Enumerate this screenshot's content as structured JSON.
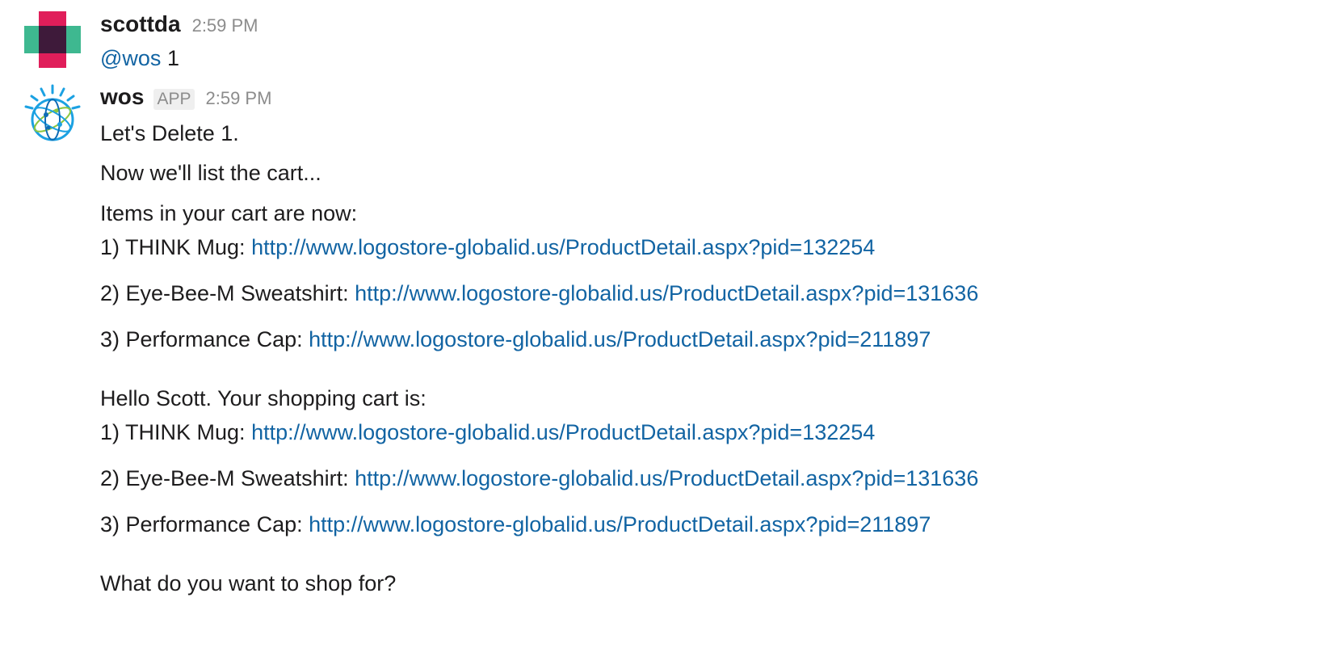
{
  "messages": [
    {
      "author": "scottda",
      "time": "2:59 PM",
      "mention": "@wos",
      "text": " 1"
    },
    {
      "author": "wos",
      "badge": "APP",
      "time": "2:59 PM",
      "lines": {
        "l1": "Let's Delete 1.",
        "l2": "Now we'll list the cart...",
        "l3": "Items in your cart are now:",
        "cart1": [
          {
            "label": "1) THINK Mug: ",
            "url": "http://www.logostore-globalid.us/ProductDetail.aspx?pid=132254"
          },
          {
            "label": "2) Eye-Bee-M Sweatshirt: ",
            "url": "http://www.logostore-globalid.us/ProductDetail.aspx?pid=131636"
          },
          {
            "label": "3) Performance Cap: ",
            "url": "http://www.logostore-globalid.us/ProductDetail.aspx?pid=211897"
          }
        ],
        "l4": "Hello Scott. Your shopping cart is:",
        "cart2": [
          {
            "label": "1) THINK Mug: ",
            "url": "http://www.logostore-globalid.us/ProductDetail.aspx?pid=132254"
          },
          {
            "label": "2) Eye-Bee-M Sweatshirt: ",
            "url": "http://www.logostore-globalid.us/ProductDetail.aspx?pid=131636"
          },
          {
            "label": "3) Performance Cap: ",
            "url": "http://www.logostore-globalid.us/ProductDetail.aspx?pid=211897"
          }
        ],
        "l5": "What do you want to shop for?"
      }
    }
  ],
  "colors": {
    "link": "#1264a3",
    "avatar_pink": "#e01e5a",
    "avatar_green": "#3eb890",
    "avatar_dark": "#3e1a3a",
    "watson_blue": "#1ba1e2",
    "watson_green": "#8cc63f"
  },
  "icons": {
    "user_avatar": "slack-like-quilt-avatar",
    "bot_avatar": "watson-globe-avatar"
  }
}
